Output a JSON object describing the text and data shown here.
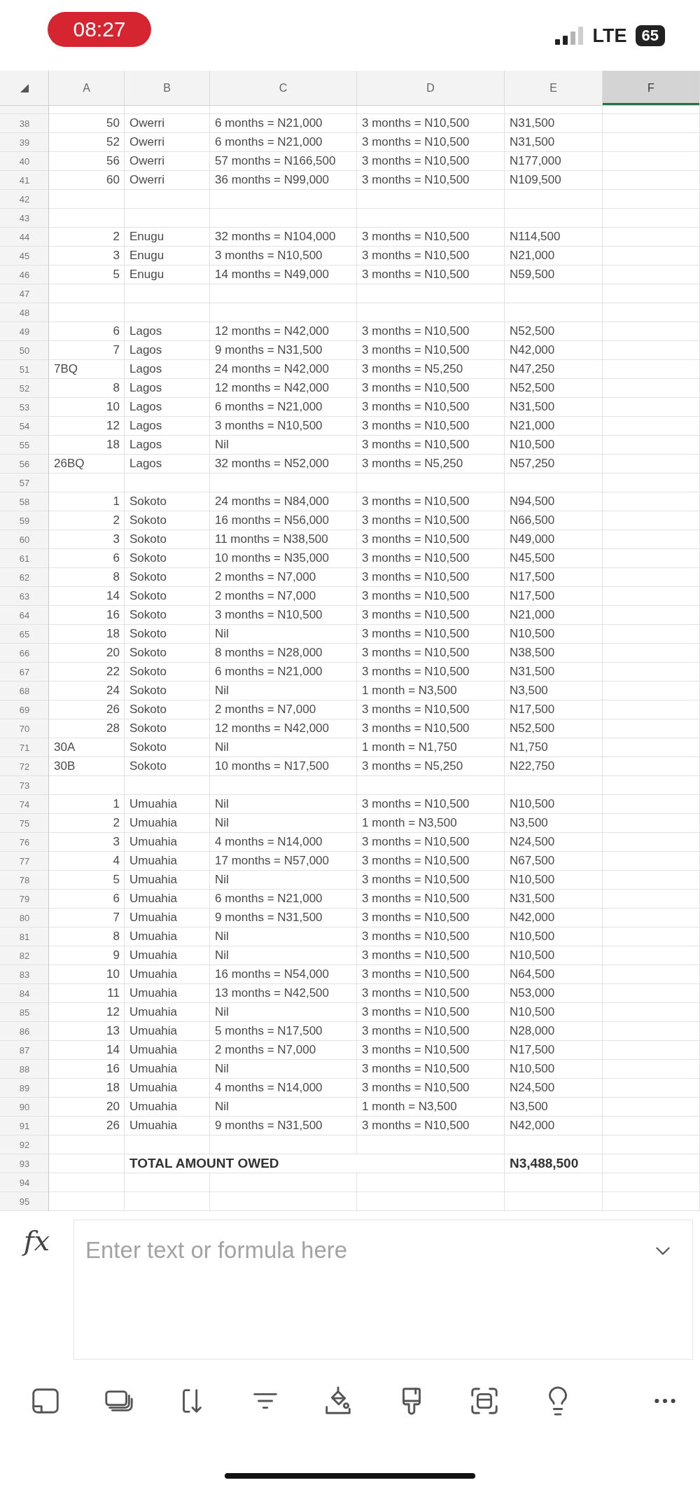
{
  "status_bar": {
    "time": "08:27",
    "network": "LTE",
    "battery": "65"
  },
  "sheet": {
    "columns": [
      {
        "label": "A",
        "selected": false
      },
      {
        "label": "B",
        "selected": false
      },
      {
        "label": "C",
        "selected": false
      },
      {
        "label": "D",
        "selected": false
      },
      {
        "label": "E",
        "selected": false
      },
      {
        "label": "F",
        "selected": true
      }
    ],
    "rows": [
      {
        "number": "38",
        "kind": "numbered",
        "cells": [
          "50",
          "Owerri",
          "6 months = N21,000",
          "3 months = N10,500",
          "N31,500"
        ]
      },
      {
        "number": "39",
        "kind": "numbered",
        "cells": [
          "52",
          "Owerri",
          "6 months = N21,000",
          "3 months = N10,500",
          "N31,500"
        ]
      },
      {
        "number": "40",
        "kind": "numbered",
        "cells": [
          "56",
          "Owerri",
          "57 months = N166,500",
          "3 months = N10,500",
          "N177,000"
        ]
      },
      {
        "number": "41",
        "kind": "numbered",
        "cells": [
          "60",
          "Owerri",
          "36 months = N99,000",
          "3 months = N10,500",
          "N109,500"
        ]
      },
      {
        "number": "42",
        "kind": "blank"
      },
      {
        "number": "43",
        "kind": "blank"
      },
      {
        "number": "44",
        "kind": "numbered",
        "cells": [
          "2",
          "Enugu",
          "32 months = N104,000",
          "3 months = N10,500",
          "N114,500"
        ]
      },
      {
        "number": "45",
        "kind": "numbered",
        "cells": [
          "3",
          "Enugu",
          "3 months = N10,500",
          "3 months = N10,500",
          "N21,000"
        ]
      },
      {
        "number": "46",
        "kind": "numbered",
        "cells": [
          "5",
          "Enugu",
          "14 months = N49,000",
          "3 months = N10,500",
          "N59,500"
        ]
      },
      {
        "number": "47",
        "kind": "blank"
      },
      {
        "number": "48",
        "kind": "blank"
      },
      {
        "number": "49",
        "kind": "numbered",
        "cells": [
          "6",
          "Lagos",
          "12 months = N42,000",
          "3 months = N10,500",
          "N52,500"
        ]
      },
      {
        "number": "50",
        "kind": "numbered",
        "cells": [
          "7",
          "Lagos",
          "9 months = N31,500",
          "3 months = N10,500",
          "N42,000"
        ]
      },
      {
        "number": "51",
        "kind": "coded",
        "cells": [
          "7BQ",
          "Lagos",
          "24 months = N42,000",
          "3 months = N5,250",
          "N47,250"
        ]
      },
      {
        "number": "52",
        "kind": "numbered",
        "cells": [
          "8",
          "Lagos",
          "12 months = N42,000",
          "3 months = N10,500",
          "N52,500"
        ]
      },
      {
        "number": "53",
        "kind": "numbered",
        "cells": [
          "10",
          "Lagos",
          "6 months = N21,000",
          "3 months = N10,500",
          "N31,500"
        ]
      },
      {
        "number": "54",
        "kind": "numbered",
        "cells": [
          "12",
          "Lagos",
          "3 months = N10,500",
          "3 months = N10,500",
          "N21,000"
        ]
      },
      {
        "number": "55",
        "kind": "numbered",
        "cells": [
          "18",
          "Lagos",
          "Nil",
          "3 months = N10,500",
          "N10,500"
        ]
      },
      {
        "number": "56",
        "kind": "coded",
        "cells": [
          "26BQ",
          "Lagos",
          "32 months = N52,000",
          "3 months = N5,250",
          "N57,250"
        ]
      },
      {
        "number": "57",
        "kind": "blank"
      },
      {
        "number": "58",
        "kind": "numbered",
        "cells": [
          "1",
          "Sokoto",
          "24 months = N84,000",
          "3 months = N10,500",
          "N94,500"
        ]
      },
      {
        "number": "59",
        "kind": "numbered",
        "cells": [
          "2",
          "Sokoto",
          "16 months = N56,000",
          "3 months = N10,500",
          "N66,500"
        ]
      },
      {
        "number": "60",
        "kind": "numbered",
        "cells": [
          "3",
          "Sokoto",
          "11 months = N38,500",
          "3 months = N10,500",
          "N49,000"
        ]
      },
      {
        "number": "61",
        "kind": "numbered",
        "cells": [
          "6",
          "Sokoto",
          "10 months = N35,000",
          "3 months = N10,500",
          "N45,500"
        ]
      },
      {
        "number": "62",
        "kind": "numbered",
        "cells": [
          "8",
          "Sokoto",
          "2 months = N7,000",
          "3 months = N10,500",
          "N17,500"
        ]
      },
      {
        "number": "63",
        "kind": "numbered",
        "cells": [
          "14",
          "Sokoto",
          "2 months = N7,000",
          "3 months = N10,500",
          "N17,500"
        ]
      },
      {
        "number": "64",
        "kind": "numbered",
        "cells": [
          "16",
          "Sokoto",
          "3 months = N10,500",
          "3 months = N10,500",
          "N21,000"
        ]
      },
      {
        "number": "65",
        "kind": "numbered",
        "cells": [
          "18",
          "Sokoto",
          "Nil",
          "3 months = N10,500",
          "N10,500"
        ]
      },
      {
        "number": "66",
        "kind": "numbered",
        "cells": [
          "20",
          "Sokoto",
          "8 months = N28,000",
          "3 months = N10,500",
          "N38,500"
        ]
      },
      {
        "number": "67",
        "kind": "numbered",
        "cells": [
          "22",
          "Sokoto",
          "6 months = N21,000",
          "3 months = N10,500",
          "N31,500"
        ]
      },
      {
        "number": "68",
        "kind": "numbered",
        "cells": [
          "24",
          "Sokoto",
          "Nil",
          "1 month = N3,500",
          "N3,500"
        ]
      },
      {
        "number": "69",
        "kind": "numbered",
        "cells": [
          "26",
          "Sokoto",
          "2 months = N7,000",
          "3 months = N10,500",
          "N17,500"
        ]
      },
      {
        "number": "70",
        "kind": "numbered",
        "cells": [
          "28",
          "Sokoto",
          "12 months = N42,000",
          "3 months = N10,500",
          "N52,500"
        ]
      },
      {
        "number": "71",
        "kind": "coded",
        "cells": [
          "30A",
          "Sokoto",
          "Nil",
          "1 month = N1,750",
          "N1,750"
        ]
      },
      {
        "number": "72",
        "kind": "coded",
        "cells": [
          "30B",
          "Sokoto",
          "10 months = N17,500",
          "3 months = N5,250",
          "N22,750"
        ]
      },
      {
        "number": "73",
        "kind": "blank"
      },
      {
        "number": "74",
        "kind": "numbered",
        "cells": [
          "1",
          "Umuahia",
          "Nil",
          "3 months = N10,500",
          "N10,500"
        ]
      },
      {
        "number": "75",
        "kind": "numbered",
        "cells": [
          "2",
          "Umuahia",
          "Nil",
          "1 month = N3,500",
          "N3,500"
        ]
      },
      {
        "number": "76",
        "kind": "numbered",
        "cells": [
          "3",
          "Umuahia",
          "4 months = N14,000",
          "3 months = N10,500",
          "N24,500"
        ]
      },
      {
        "number": "77",
        "kind": "numbered",
        "cells": [
          "4",
          "Umuahia",
          "17 months = N57,000",
          "3 months = N10,500",
          "N67,500"
        ]
      },
      {
        "number": "78",
        "kind": "numbered",
        "cells": [
          "5",
          "Umuahia",
          "Nil",
          "3 months = N10,500",
          "N10,500"
        ]
      },
      {
        "number": "79",
        "kind": "numbered",
        "cells": [
          "6",
          "Umuahia",
          "6 months = N21,000",
          "3 months = N10,500",
          "N31,500"
        ]
      },
      {
        "number": "80",
        "kind": "numbered",
        "cells": [
          "7",
          "Umuahia",
          "9 months = N31,500",
          "3 months = N10,500",
          "N42,000"
        ]
      },
      {
        "number": "81",
        "kind": "numbered",
        "cells": [
          "8",
          "Umuahia",
          "Nil",
          "3 months = N10,500",
          "N10,500"
        ]
      },
      {
        "number": "82",
        "kind": "numbered",
        "cells": [
          "9",
          "Umuahia",
          "Nil",
          "3 months = N10,500",
          "N10,500"
        ]
      },
      {
        "number": "83",
        "kind": "numbered",
        "cells": [
          "10",
          "Umuahia",
          "16 months = N54,000",
          "3 months = N10,500",
          "N64,500"
        ]
      },
      {
        "number": "84",
        "kind": "numbered",
        "cells": [
          "11",
          "Umuahia",
          "13 months = N42,500",
          "3 months = N10,500",
          "N53,000"
        ]
      },
      {
        "number": "85",
        "kind": "numbered",
        "cells": [
          "12",
          "Umuahia",
          "Nil",
          "3 months = N10,500",
          "N10,500"
        ]
      },
      {
        "number": "86",
        "kind": "numbered",
        "cells": [
          "13",
          "Umuahia",
          "5 months = N17,500",
          "3 months = N10,500",
          "N28,000"
        ]
      },
      {
        "number": "87",
        "kind": "numbered",
        "cells": [
          "14",
          "Umuahia",
          "2 months = N7,000",
          "3 months = N10,500",
          "N17,500"
        ]
      },
      {
        "number": "88",
        "kind": "numbered",
        "cells": [
          "16",
          "Umuahia",
          "Nil",
          "3 months = N10,500",
          "N10,500"
        ]
      },
      {
        "number": "89",
        "kind": "numbered",
        "cells": [
          "18",
          "Umuahia",
          "4 months = N14,000",
          "3 months = N10,500",
          "N24,500"
        ]
      },
      {
        "number": "90",
        "kind": "numbered",
        "cells": [
          "20",
          "Umuahia",
          "Nil",
          "1 month = N3,500",
          "N3,500"
        ]
      },
      {
        "number": "91",
        "kind": "numbered",
        "cells": [
          "26",
          "Umuahia",
          "9 months = N31,500",
          "3 months = N10,500",
          "N42,000"
        ]
      },
      {
        "number": "92",
        "kind": "blank"
      },
      {
        "number": "93",
        "kind": "total",
        "label": "TOTAL AMOUNT OWED",
        "amount": "N3,488,500"
      },
      {
        "number": "94",
        "kind": "blank"
      },
      {
        "number": "95",
        "kind": "blank"
      }
    ]
  },
  "formula_bar": {
    "function_label": "fx",
    "placeholder": "Enter text or formula here"
  }
}
